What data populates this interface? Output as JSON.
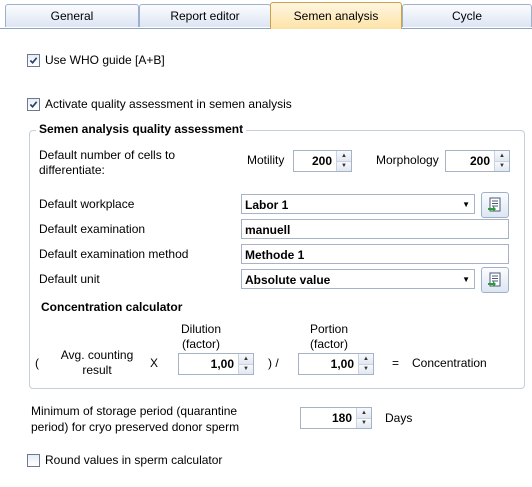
{
  "tabs": [
    {
      "label": "General"
    },
    {
      "label": "Report editor"
    },
    {
      "label": "Semen analysis"
    },
    {
      "label": "Cycle"
    }
  ],
  "use_who_guide": {
    "label": "Use WHO guide [A+B]",
    "checked": true
  },
  "activate_quality": {
    "label": "Activate quality assessment in semen analysis",
    "checked": true
  },
  "quality_group": {
    "title": "Semen analysis quality assessment",
    "cells_label_line1": "Default number of cells to",
    "cells_label_line2": "differentiate:",
    "motility_label": "Motility",
    "motility_value": "200",
    "morphology_label": "Morphology",
    "morphology_value": "200",
    "workplace_label": "Default workplace",
    "workplace_value": "Labor 1",
    "examination_label": "Default examination",
    "examination_value": "manuell",
    "method_label": "Default examination method",
    "method_value": "Methode 1",
    "unit_label": "Default unit",
    "unit_value": "Absolute value"
  },
  "calculator": {
    "title": "Concentration calculator",
    "open_paren": "(",
    "avg_line1": "Avg. counting",
    "avg_line2": "result",
    "times": "X",
    "dilution_line1": "Dilution",
    "dilution_line2": "(factor)",
    "dilution_value": "1,00",
    "close_div": ") /",
    "portion_line1": "Portion",
    "portion_line2": "(factor)",
    "portion_value": "1,00",
    "equals": "=",
    "result_label": "Concentration"
  },
  "storage": {
    "label_line1": "Minimum of storage period (quarantine",
    "label_line2": "period) for cryo preserved donor sperm",
    "value": "180",
    "unit": "Days"
  },
  "round_values": {
    "label": "Round values in sperm calculator",
    "checked": false
  },
  "icons": {
    "check": "checkmark-icon",
    "lookup": "list-lookup-icon",
    "dropdown": "chevron-down-icon"
  }
}
